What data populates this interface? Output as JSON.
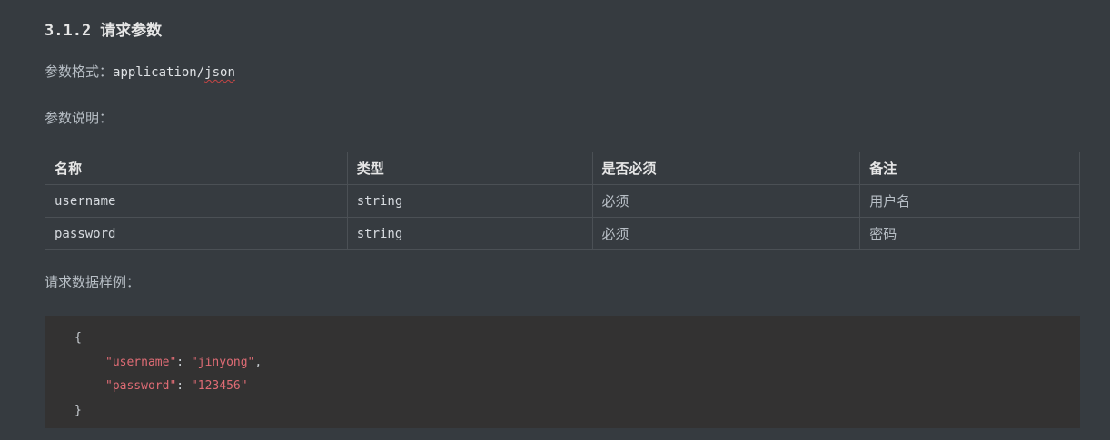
{
  "section": {
    "number": "3.1.2",
    "title": "请求参数"
  },
  "format": {
    "label": "参数格式：",
    "value_prefix": "application/",
    "value_flagged": "json"
  },
  "description_label": "参数说明：",
  "table": {
    "headers": [
      "名称",
      "类型",
      "是否必须",
      "备注"
    ],
    "rows": [
      {
        "name": "username",
        "type": "string",
        "required": "必须",
        "note": "用户名"
      },
      {
        "name": "password",
        "type": "string",
        "required": "必须",
        "note": "密码"
      }
    ]
  },
  "sample_label": "请求数据样例：",
  "sample_code": {
    "open": "{",
    "lines": [
      {
        "key": "\"username\"",
        "sep": ": ",
        "value": "\"jinyong\"",
        "tail": ","
      },
      {
        "key": "\"password\"",
        "sep": ": ",
        "value": "\"123456\"",
        "tail": ""
      }
    ],
    "close": "}"
  },
  "colors": {
    "background": "#363b40",
    "code_background": "#333232",
    "json_string": "#e06c75",
    "spellcheck_underline": "#c64545"
  }
}
